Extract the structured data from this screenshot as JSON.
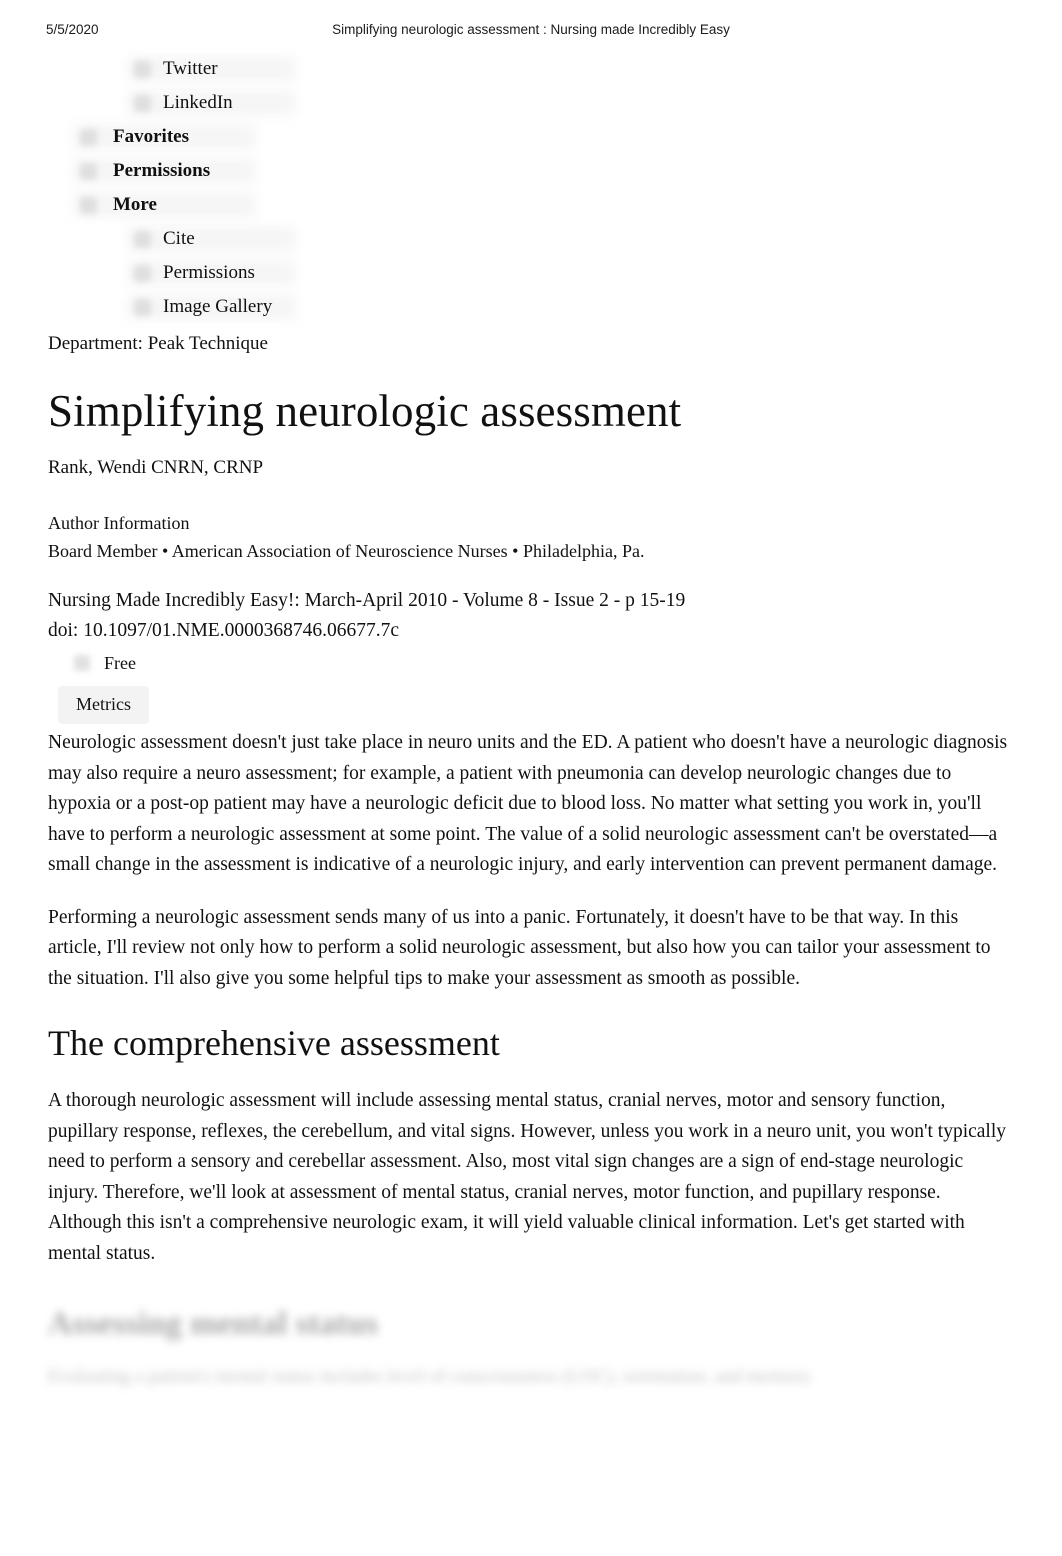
{
  "print_header": {
    "date": "5/5/2020",
    "title": "Simplifying neurologic assessment : Nursing made Incredibly Easy"
  },
  "tools_menu": {
    "items": [
      {
        "label": "Twitter",
        "level": "sub",
        "icon": "twitter-icon"
      },
      {
        "label": "LinkedIn",
        "level": "sub",
        "icon": "linkedin-icon"
      },
      {
        "label": "Favorites",
        "level": "top",
        "icon": "star-icon"
      },
      {
        "label": "Permissions",
        "level": "top",
        "icon": "permissions-icon"
      },
      {
        "label": "More",
        "level": "top",
        "icon": "more-icon"
      },
      {
        "label": "Cite",
        "level": "sub",
        "icon": "cite-icon"
      },
      {
        "label": "Permissions",
        "level": "sub",
        "icon": "permissions-icon"
      },
      {
        "label": "Image Gallery",
        "level": "sub",
        "icon": "image-gallery-icon"
      }
    ]
  },
  "article": {
    "department": "Department: Peak Technique",
    "title": "Simplifying neurologic assessment",
    "byline": "Rank, Wendi CNRN, CRNP",
    "author_info_heading": "Author Information",
    "author_affiliation": "Board Member • American Association of Neuroscience Nurses • Philadelphia, Pa.",
    "citation": "Nursing Made Incredibly Easy!: March-April 2010 - Volume 8 - Issue 2 - p 15-19",
    "doi": "doi: 10.1097/01.NME.0000368746.06677.7c",
    "free_label": "Free",
    "metrics_label": "Metrics",
    "paragraphs": [
      "Neurologic assessment doesn't just take place in neuro units and the ED. A patient who doesn't have a neurologic diagnosis may also require a neuro assessment; for example, a patient with pneumonia can develop neurologic changes due to hypoxia or a post-op patient may have a neurologic deficit due to blood loss. No matter what setting you work in, you'll have to perform a neurologic assessment at some point. The value of a solid neurologic assessment can't be overstated—a small change in the assessment is indicative of a neurologic injury, and early intervention can prevent permanent damage.",
      "Performing a neurologic assessment sends many of us into a panic. Fortunately, it doesn't have to be that way. In this article, I'll review not only how to perform a solid neurologic assessment, but also how you can tailor your assessment to the situation. I'll also give you some helpful tips to make your assessment as smooth as possible."
    ],
    "section_title": "The comprehensive assessment",
    "section_paragraph": "A thorough neurologic assessment will include assessing mental status, cranial nerves, motor and sensory function, pupillary response, reflexes, the cerebellum, and vital signs. However, unless you work in a neuro unit, you won't typically need to perform a sensory and cerebellar assessment. Also, most vital sign changes are a sign of end-stage neurologic injury. Therefore, we'll look at assessment of mental status, cranial nerves, motor function, and pupillary response. Although this isn't a comprehensive neurologic exam, it will yield valuable clinical information. Let's get started with mental status.",
    "faded_heading": "Assessing mental status",
    "faded_line": "Evaluating a patient's mental status includes level of consciousness (LOC), orientation, and memory."
  }
}
